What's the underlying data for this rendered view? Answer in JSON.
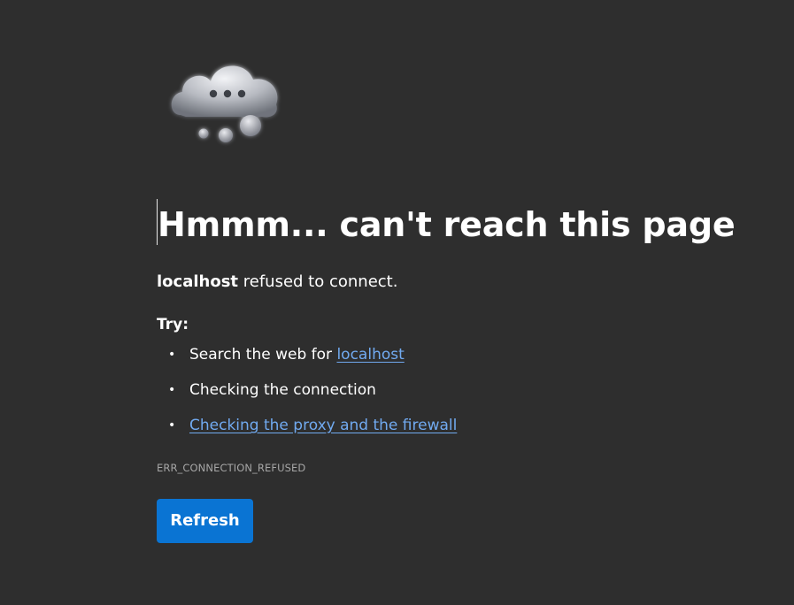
{
  "illustration": {
    "icon": "thinking-cloud-icon"
  },
  "error": {
    "title": "Hmmm... can't reach this page",
    "host": "localhost",
    "message_suffix": " refused to connect.",
    "try_label": "Try:",
    "suggestions": [
      {
        "prefix": "Search the web for ",
        "link": "localhost"
      },
      {
        "text": "Checking the connection"
      },
      {
        "link": "Checking the proxy and the firewall"
      }
    ],
    "code": "ERR_CONNECTION_REFUSED"
  },
  "actions": {
    "refresh_label": "Refresh"
  },
  "colors": {
    "background": "#2e2e2e",
    "link": "#71aaf0",
    "button": "#0a74d3",
    "muted_text": "#a6a6a6"
  }
}
